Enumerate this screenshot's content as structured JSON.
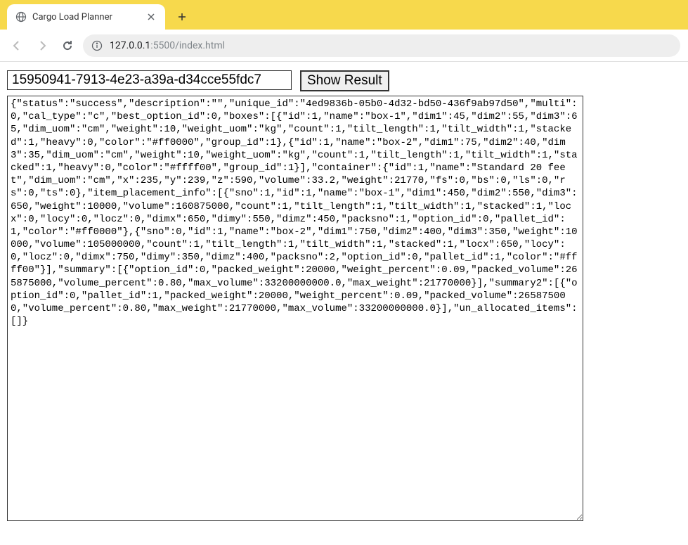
{
  "browser": {
    "tab_title": "Cargo Load Planner",
    "url_host": "127.0.0.1",
    "url_path": ":5500/index.html"
  },
  "controls": {
    "input_value": "15950941-7913-4e23-a39a-d34cce55fdc7",
    "button_label": "Show Result"
  },
  "result_text": "{\"status\":\"success\",\"description\":\"\",\"unique_id\":\"4ed9836b-05b0-4d32-bd50-436f9ab97d50\",\"multi\":0,\"cal_type\":\"c\",\"best_option_id\":0,\"boxes\":[{\"id\":1,\"name\":\"box-1\",\"dim1\":45,\"dim2\":55,\"dim3\":65,\"dim_uom\":\"cm\",\"weight\":10,\"weight_uom\":\"kg\",\"count\":1,\"tilt_length\":1,\"tilt_width\":1,\"stacked\":1,\"heavy\":0,\"color\":\"#ff0000\",\"group_id\":1},{\"id\":1,\"name\":\"box-2\",\"dim1\":75,\"dim2\":40,\"dim3\":35,\"dim_uom\":\"cm\",\"weight\":10,\"weight_uom\":\"kg\",\"count\":1,\"tilt_length\":1,\"tilt_width\":1,\"stacked\":1,\"heavy\":0,\"color\":\"#ffff00\",\"group_id\":1}],\"container\":{\"id\":1,\"name\":\"Standard 20 feet\",\"dim_uom\":\"cm\",\"x\":235,\"y\":239,\"z\":590,\"volume\":33.2,\"weight\":21770,\"fs\":0,\"bs\":0,\"ls\":0,\"rs\":0,\"ts\":0},\"item_placement_info\":[{\"sno\":1,\"id\":1,\"name\":\"box-1\",\"dim1\":450,\"dim2\":550,\"dim3\":650,\"weight\":10000,\"volume\":160875000,\"count\":1,\"tilt_length\":1,\"tilt_width\":1,\"stacked\":1,\"locx\":0,\"locy\":0,\"locz\":0,\"dimx\":650,\"dimy\":550,\"dimz\":450,\"packsno\":1,\"option_id\":0,\"pallet_id\":1,\"color\":\"#ff0000\"},{\"sno\":0,\"id\":1,\"name\":\"box-2\",\"dim1\":750,\"dim2\":400,\"dim3\":350,\"weight\":10000,\"volume\":105000000,\"count\":1,\"tilt_length\":1,\"tilt_width\":1,\"stacked\":1,\"locx\":650,\"locy\":0,\"locz\":0,\"dimx\":750,\"dimy\":350,\"dimz\":400,\"packsno\":2,\"option_id\":0,\"pallet_id\":1,\"color\":\"#ffff00\"}],\"summary\":[{\"option_id\":0,\"packed_weight\":20000,\"weight_percent\":0.09,\"packed_volume\":265875000,\"volume_percent\":0.80,\"max_volume\":33200000000.0,\"max_weight\":21770000}],\"summary2\":[{\"option_id\":0,\"pallet_id\":1,\"packed_weight\":20000,\"weight_percent\":0.09,\"packed_volume\":265875000,\"volume_percent\":0.80,\"max_weight\":21770000,\"max_volume\":33200000000.0}],\"un_allocated_items\":[]}"
}
